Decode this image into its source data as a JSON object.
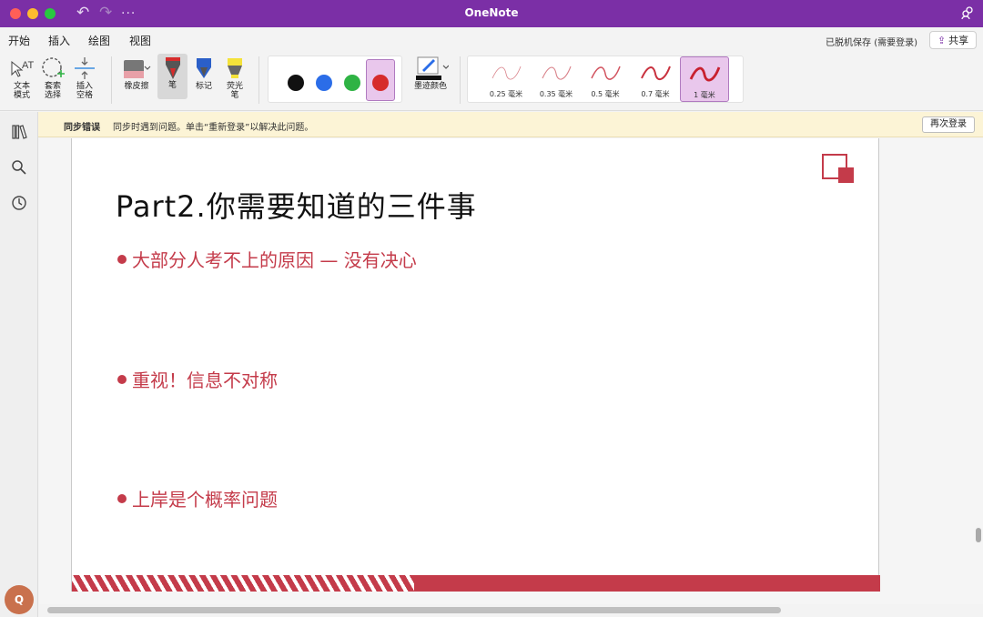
{
  "window": {
    "title": "OneNote"
  },
  "tabs": [
    {
      "label": "开始"
    },
    {
      "label": "插入"
    },
    {
      "label": "绘图"
    },
    {
      "label": "视图"
    }
  ],
  "active_tab": "绘图",
  "header": {
    "save_status": "已脱机保存 (需要登录)",
    "share_label": "共享"
  },
  "ribbon": {
    "text_mode": "文本\n模式",
    "lasso": "套索\n选择",
    "insert_space": "插入\n空格",
    "eraser": "橡皮擦",
    "pen": "笔",
    "marker": "标记",
    "highlighter": "荧光\n笔",
    "ink_color": "墨迹颜色",
    "colors": [
      "#111111",
      "#2b6de8",
      "#2fb344",
      "#d62b2b"
    ],
    "selected_color_index": 3,
    "widths": [
      {
        "label": "0.25 毫米"
      },
      {
        "label": "0.35 毫米"
      },
      {
        "label": "0.5 毫米"
      },
      {
        "label": "0.7 毫米"
      },
      {
        "label": "1 毫米"
      }
    ],
    "selected_width_index": 4
  },
  "notice": {
    "title": "同步错误",
    "message": "同步时遇到问题。单击“重新登录”以解决此问题。",
    "button": "再次登录"
  },
  "sidebar": {
    "avatar_initial": "Q"
  },
  "slide": {
    "title": "Part2.你需要知道的三件事",
    "bullets": [
      "大部分人考不上的原因 — 没有决心",
      "重视！信息不对称",
      "上岸是个概率问题"
    ],
    "accent_color": "#c43b4a"
  }
}
